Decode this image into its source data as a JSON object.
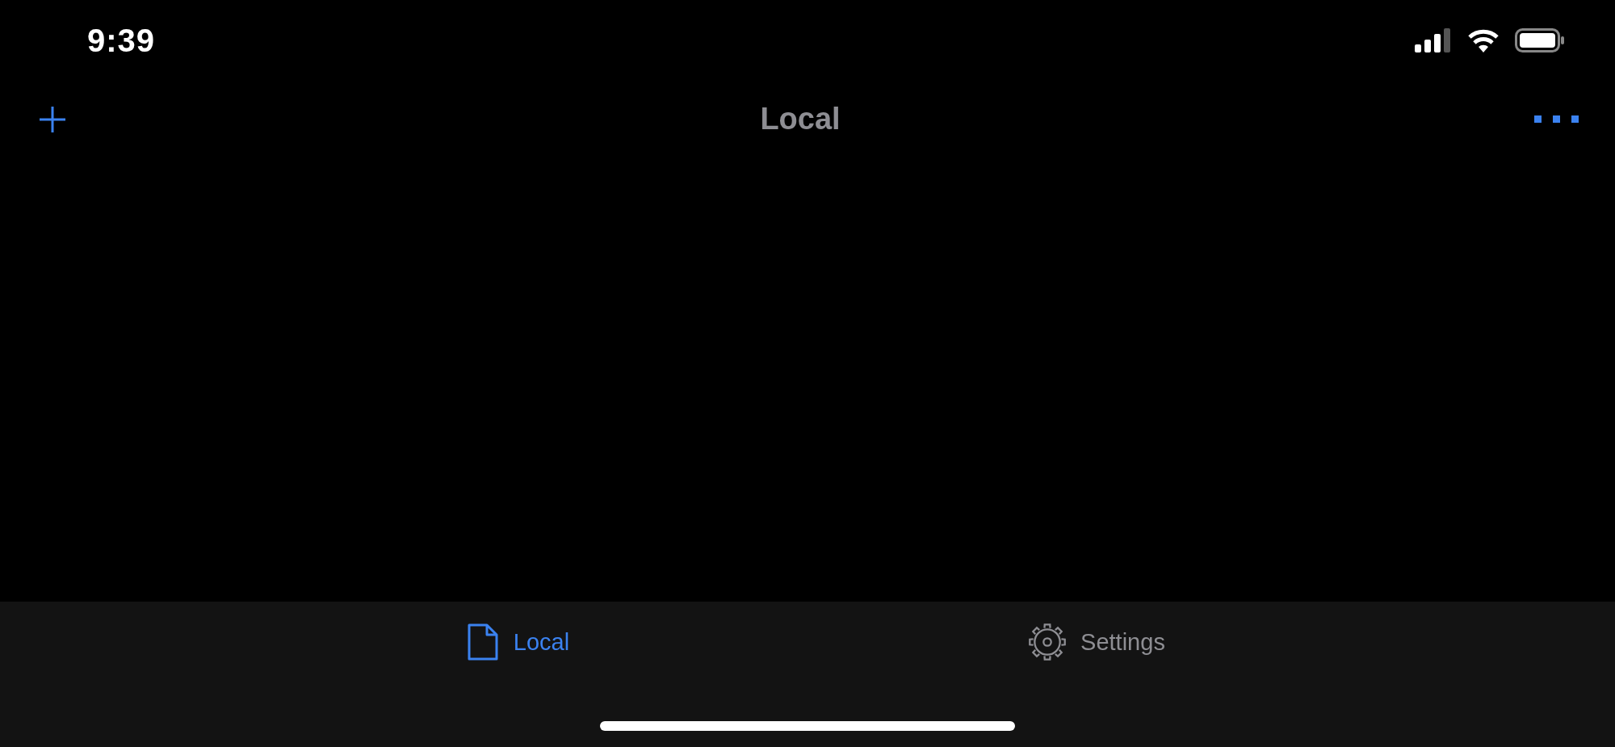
{
  "status_bar": {
    "time": "9:39"
  },
  "nav_bar": {
    "title": "Local"
  },
  "tab_bar": {
    "tabs": [
      {
        "label": "Local",
        "kind": "document",
        "selected": true
      },
      {
        "label": "Settings",
        "kind": "gear",
        "selected": false
      }
    ]
  }
}
